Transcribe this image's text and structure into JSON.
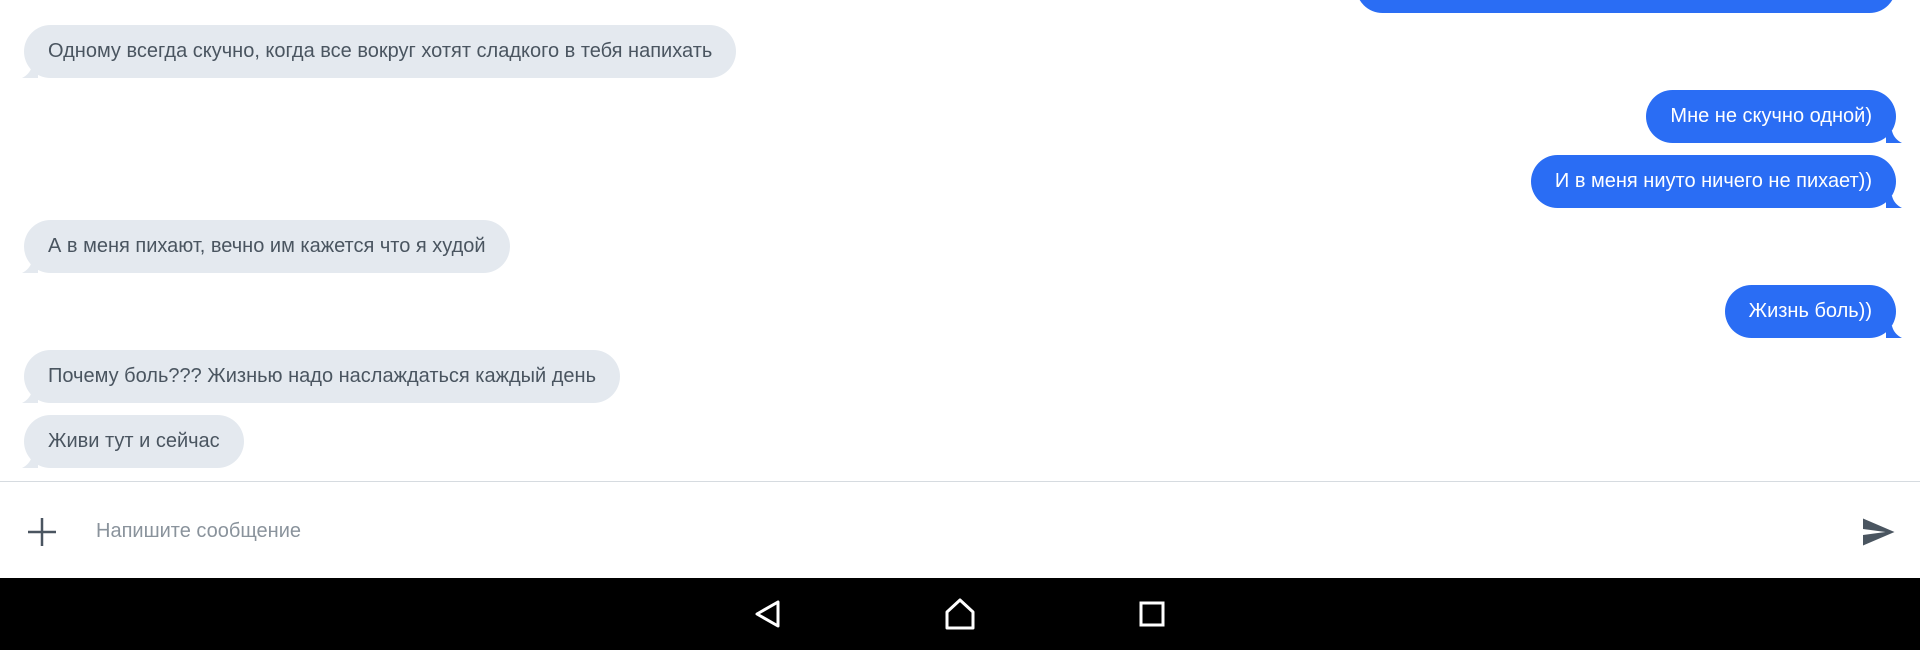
{
  "chat": {
    "messages": [
      {
        "side": "in",
        "text": "Одному всегда скучно, когда все вокруг хотят сладкого в тебя напихать"
      },
      {
        "side": "out",
        "text": "Мне не скучно одной)"
      },
      {
        "side": "out",
        "text": "И в меня ниуто ничего не пихает))"
      },
      {
        "side": "in",
        "text": "А в меня пихают, вечно им кажется что я худой"
      },
      {
        "side": "out",
        "text": "Жизнь боль))"
      },
      {
        "side": "in",
        "text": "Почему боль??? Жизнью надо наслаждаться каждый день"
      },
      {
        "side": "in",
        "text": "Живи тут и сейчас"
      }
    ]
  },
  "composer": {
    "placeholder": "Напишите сообщение",
    "value": "",
    "add_icon": "plus-icon",
    "send_icon": "send-icon"
  },
  "navbar": {
    "back_icon": "back-triangle-icon",
    "home_icon": "home-icon",
    "recents_icon": "recents-square-icon"
  },
  "colors": {
    "incoming_bubble": "#e4e9ef",
    "outgoing_bubble": "#2a6df4",
    "incoming_text": "#4a5560",
    "outgoing_text": "#ffffff",
    "navbar": "#000000"
  }
}
